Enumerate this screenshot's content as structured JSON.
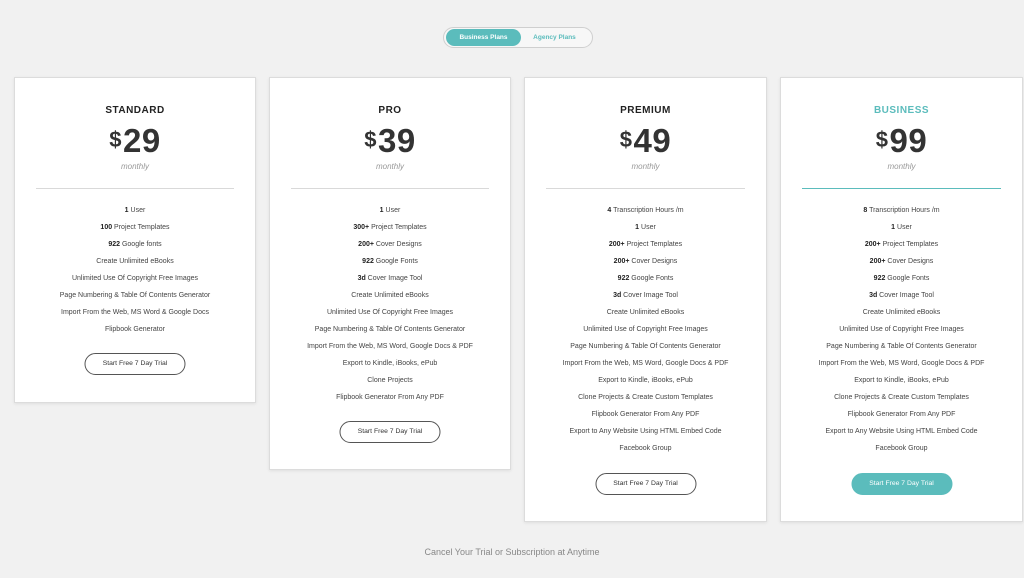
{
  "toggle": {
    "business_label": "Business Plans",
    "agency_label": "Agency Plans"
  },
  "accent_color": "#5bbcbc",
  "plans": [
    {
      "name": "STANDARD",
      "currency": "$",
      "amount": "29",
      "period": "monthly",
      "features": [
        {
          "bold": "1",
          "text": " User"
        },
        {
          "bold": "100",
          "text": " Project Templates"
        },
        {
          "bold": "922",
          "text": " Google fonts"
        },
        {
          "bold": "",
          "text": "Create Unlimited eBooks"
        },
        {
          "bold": "",
          "text": "Unlimited Use Of Copyright Free Images"
        },
        {
          "bold": "",
          "text": "Page Numbering & Table Of Contents Generator"
        },
        {
          "bold": "",
          "text": "Import From the Web, MS Word & Google Docs"
        },
        {
          "bold": "",
          "text": "Flipbook Generator"
        }
      ],
      "button": "Start Free 7 Day Trial"
    },
    {
      "name": "PRO",
      "currency": "$",
      "amount": "39",
      "period": "monthly",
      "features": [
        {
          "bold": "1",
          "text": " User"
        },
        {
          "bold": "300+",
          "text": " Project Templates"
        },
        {
          "bold": "200+",
          "text": " Cover Designs"
        },
        {
          "bold": "922",
          "text": " Google Fonts"
        },
        {
          "bold": "3d",
          "text": " Cover Image Tool"
        },
        {
          "bold": "",
          "text": "Create Unlimited eBooks"
        },
        {
          "bold": "",
          "text": "Unlimited Use Of Copyright Free Images"
        },
        {
          "bold": "",
          "text": "Page Numbering & Table Of Contents Generator"
        },
        {
          "bold": "",
          "text": "Import From the Web, MS Word, Google Docs & PDF"
        },
        {
          "bold": "",
          "text": "Export to Kindle, iBooks, ePub"
        },
        {
          "bold": "",
          "text": "Clone Projects"
        },
        {
          "bold": "",
          "text": "Flipbook Generator From Any PDF"
        }
      ],
      "button": "Start Free 7 Day Trial"
    },
    {
      "name": "PREMIUM",
      "currency": "$",
      "amount": "49",
      "period": "monthly",
      "features": [
        {
          "bold": "4",
          "text": " Transcription Hours /m"
        },
        {
          "bold": "1",
          "text": " User"
        },
        {
          "bold": "200+",
          "text": " Project Templates"
        },
        {
          "bold": "200+",
          "text": " Cover Designs"
        },
        {
          "bold": "922",
          "text": " Google Fonts"
        },
        {
          "bold": "3d",
          "text": " Cover Image Tool"
        },
        {
          "bold": "",
          "text": "Create Unlimited eBooks"
        },
        {
          "bold": "",
          "text": "Unlimited Use of Copyright Free Images"
        },
        {
          "bold": "",
          "text": "Page Numbering & Table Of Contents Generator"
        },
        {
          "bold": "",
          "text": "Import From the Web, MS Word, Google Docs & PDF"
        },
        {
          "bold": "",
          "text": "Export to Kindle, iBooks, ePub"
        },
        {
          "bold": "",
          "text": "Clone Projects & Create Custom Templates"
        },
        {
          "bold": "",
          "text": "Flipbook Generator From Any PDF"
        },
        {
          "bold": "",
          "text": "Export to Any Website Using HTML Embed Code"
        },
        {
          "bold": "",
          "text": "Facebook Group"
        }
      ],
      "button": "Start Free 7 Day Trial"
    },
    {
      "name": "BUSINESS",
      "currency": "$",
      "amount": "99",
      "period": "monthly",
      "features": [
        {
          "bold": "8",
          "text": " Transcription Hours /m"
        },
        {
          "bold": "1",
          "text": " User"
        },
        {
          "bold": "200+",
          "text": " Project Templates"
        },
        {
          "bold": "200+",
          "text": " Cover Designs"
        },
        {
          "bold": "922",
          "text": " Google Fonts"
        },
        {
          "bold": "3d",
          "text": " Cover Image Tool"
        },
        {
          "bold": "",
          "text": "Create Unlimited eBooks"
        },
        {
          "bold": "",
          "text": "Unlimited Use of Copyright Free Images"
        },
        {
          "bold": "",
          "text": "Page Numbering & Table Of Contents Generator"
        },
        {
          "bold": "",
          "text": "Import From the Web, MS Word, Google Docs & PDF"
        },
        {
          "bold": "",
          "text": "Export to Kindle, iBooks, ePub"
        },
        {
          "bold": "",
          "text": "Clone Projects & Create Custom Templates"
        },
        {
          "bold": "",
          "text": "Flipbook Generator From Any PDF"
        },
        {
          "bold": "",
          "text": "Export to Any Website Using HTML Embed Code"
        },
        {
          "bold": "",
          "text": "Facebook Group"
        }
      ],
      "button": "Start Free 7 Day Trial"
    }
  ],
  "footer": {
    "text": "Cancel Your Trial or Subscription at Anytime"
  }
}
